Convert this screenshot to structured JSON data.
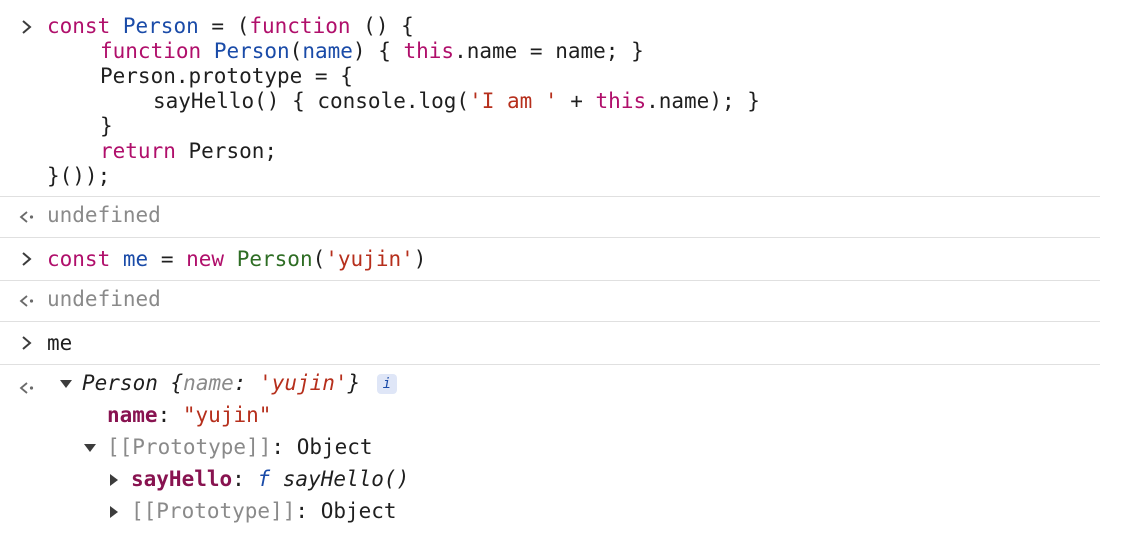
{
  "input1": {
    "line1": {
      "t1": "const",
      "t2": "Person",
      "t3": "=",
      "t4": "(",
      "t5": "function",
      "t6": "() {"
    },
    "line2": {
      "t1": "function",
      "t2": "Person",
      "t3": "(",
      "t4": "name",
      "t5": ") {",
      "t6": "this",
      "t7": ".name = name; }"
    },
    "line3": {
      "t1": "Person.prototype = {"
    },
    "line4": {
      "t1": "sayHello() { console.log(",
      "t2": "'I am '",
      "t3": " + ",
      "t4": "this",
      "t5": ".name); }"
    },
    "line5": {
      "t1": "}"
    },
    "line6": {
      "t1": "return",
      "t2": "Person;"
    },
    "line7": {
      "t1": "}());"
    }
  },
  "output1": {
    "text": "undefined"
  },
  "input2": {
    "t1": "const",
    "t2": "me",
    "t3": "=",
    "t4": "new",
    "t5": "Person",
    "t6": "(",
    "t7": "'yujin'",
    "t8": ")"
  },
  "output2": {
    "text": "undefined"
  },
  "input3": {
    "text": "me"
  },
  "output3": {
    "summary": {
      "class_name": "Person",
      "open": "{",
      "key": "name",
      "colon": ":",
      "value": "'yujin'",
      "close": "}",
      "info": "i"
    },
    "name_prop": {
      "key": "name",
      "colon": ":",
      "value": "\"yujin\""
    },
    "proto": {
      "key": "[[Prototype]]",
      "colon": ":",
      "value": "Object"
    },
    "sayhello_prop": {
      "key": "sayHello",
      "colon": ":",
      "f": "f",
      "value": "sayHello()"
    },
    "proto2": {
      "key": "[[Prototype]]",
      "colon": ":",
      "value": "Object"
    }
  },
  "colors": {
    "keyword": "#b00f6b",
    "function_name": "#1a4ba8",
    "string": "#b62f1c",
    "class_name": "#2e6d24",
    "prop_key": "#881350",
    "dim": "#8a8a8a"
  },
  "icons": {
    "input_prompt": "chevron-right-icon",
    "output_prompt": "return-arrow-icon",
    "expand": "triangle-down-icon",
    "collapse": "triangle-right-icon"
  }
}
